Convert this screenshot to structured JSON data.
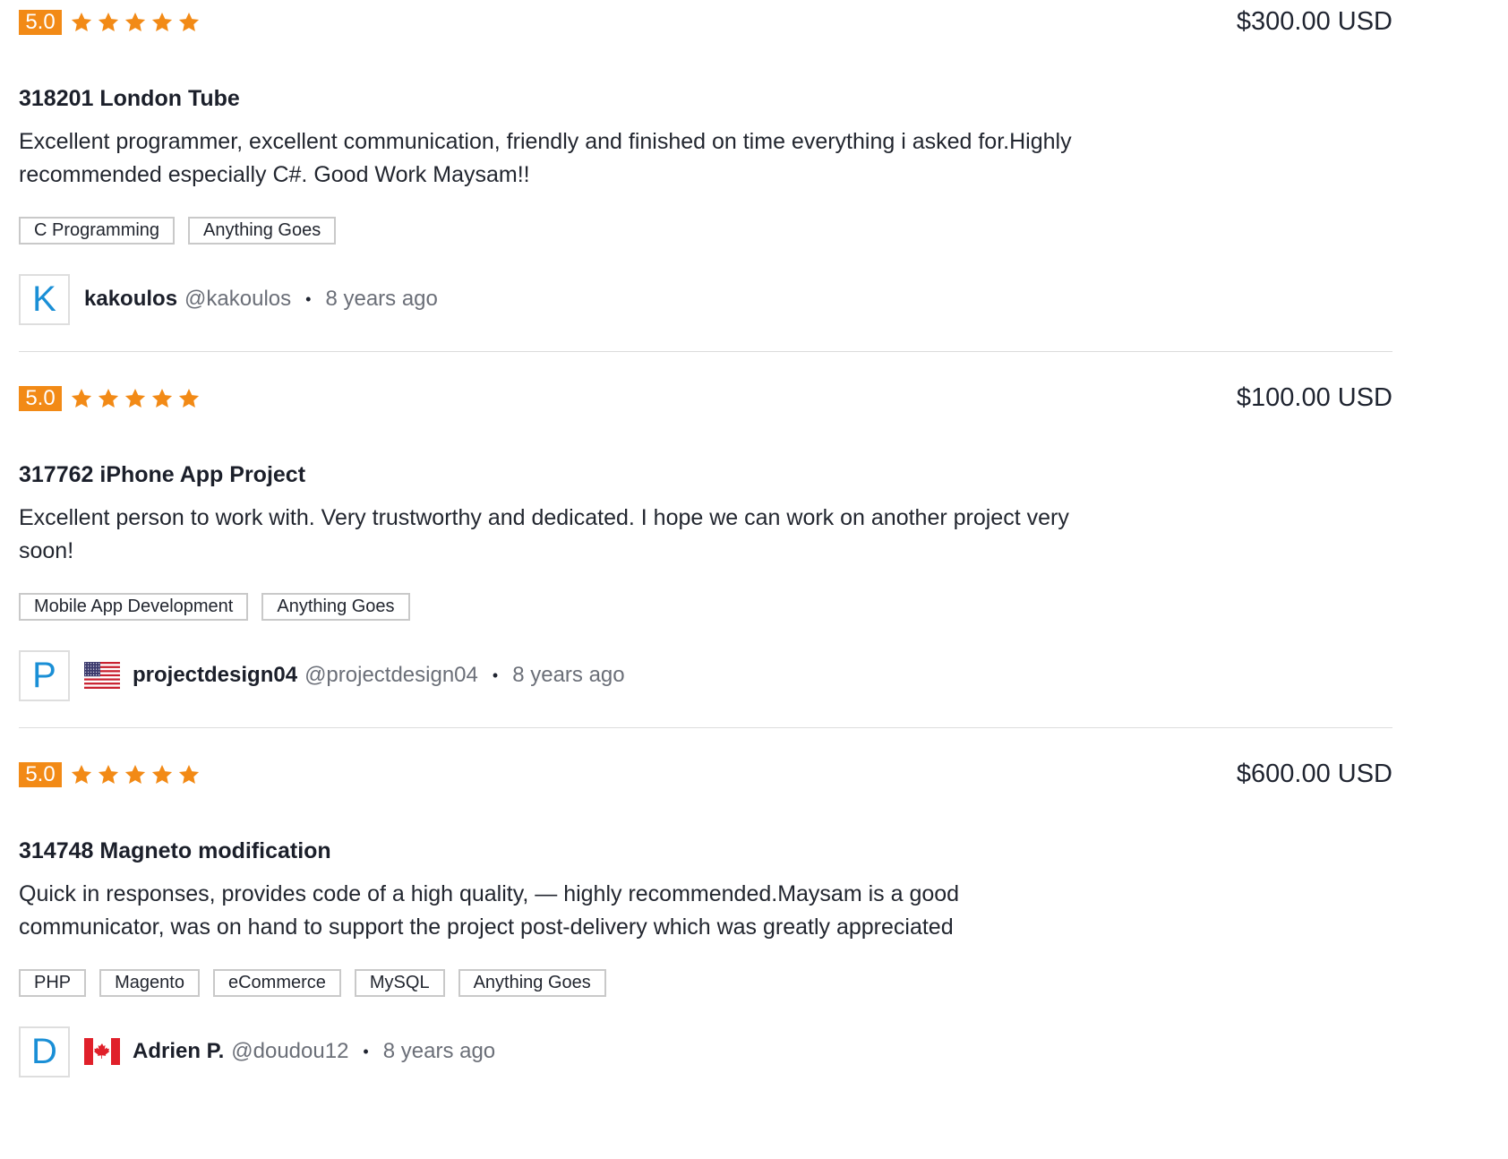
{
  "colors": {
    "accent": "#f28a16",
    "avatar_letter": "#1a8fd6",
    "tag_border": "#c9c9c9"
  },
  "reviews": [
    {
      "score": "5.0",
      "stars": 5,
      "price": "$300.00 USD",
      "title": "318201 London Tube",
      "comment": "Excellent programmer, excellent communication, friendly and finished on time everything i asked for.Highly recommended especially C#. Good Work Maysam!!",
      "tags": [
        "C Programming",
        "Anything Goes"
      ],
      "avatar_letter": "K",
      "flag": "",
      "name": "kakoulos",
      "handle": "@kakoulos",
      "separator": "•",
      "time": "8 years ago"
    },
    {
      "score": "5.0",
      "stars": 5,
      "price": "$100.00 USD",
      "title": "317762 iPhone App Project",
      "comment": "Excellent person to work with. Very trustworthy and dedicated. I hope we can work on another project very soon!",
      "tags": [
        "Mobile App Development",
        "Anything Goes"
      ],
      "avatar_letter": "P",
      "flag": "us-flag-icon",
      "name": "projectdesign04",
      "handle": "@projectdesign04",
      "separator": "•",
      "time": "8 years ago"
    },
    {
      "score": "5.0",
      "stars": 5,
      "price": "$600.00 USD",
      "title": "314748 Magneto modification",
      "comment": "Quick in responses, provides code of a high quality, — highly recommended.Maysam is a good communicator, was on hand to support the project post-delivery which was greatly appreciated",
      "tags": [
        "PHP",
        "Magento",
        "eCommerce",
        "MySQL",
        "Anything Goes"
      ],
      "avatar_letter": "D",
      "flag": "canada-flag-icon",
      "name": "Adrien P.",
      "handle": "@doudou12",
      "separator": "•",
      "time": "8 years ago"
    }
  ]
}
